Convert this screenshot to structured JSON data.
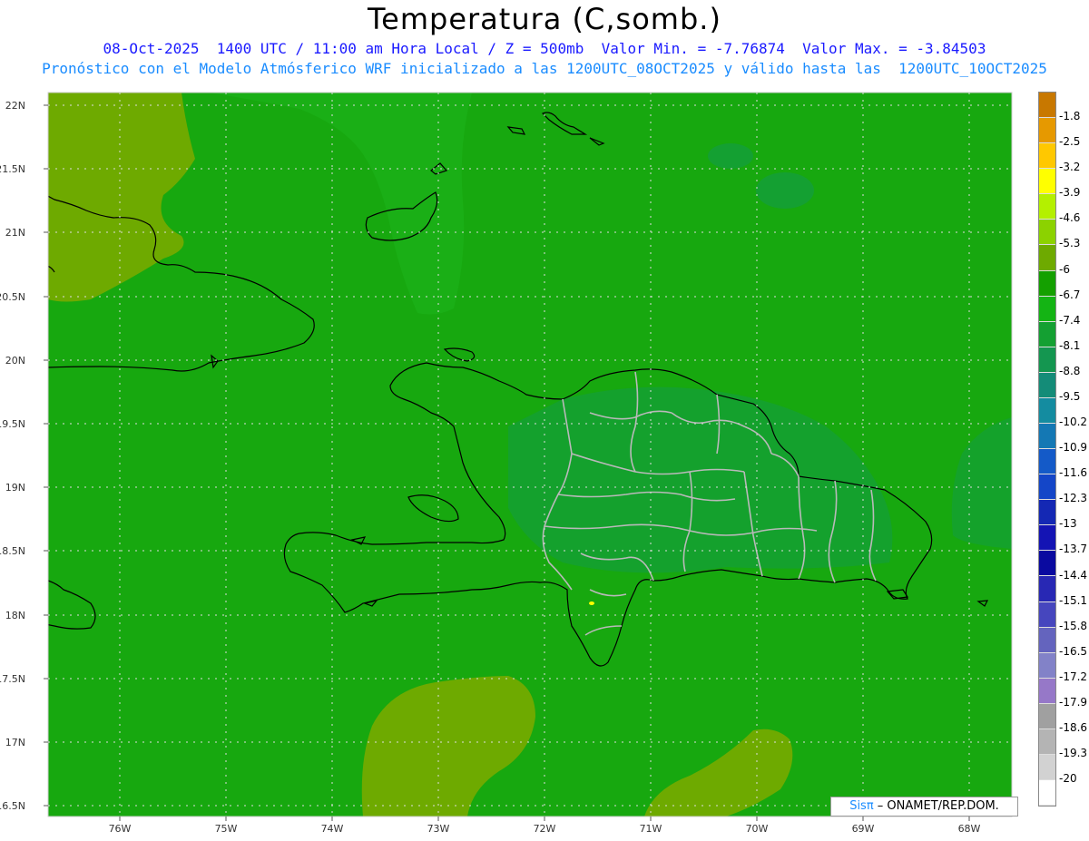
{
  "header": {
    "title": "Temperatura (C,somb.)",
    "line1": "08-Oct-2025  1400 UTC / 11:00 am Hora Local / Z = 500mb  Valor Min. = -7.76874  Valor Max. = -3.84503",
    "line2": "Pronóstico con el Modelo Atmósferico WRF inicializado a las 1200UTC_08OCT2025 y válido hasta las  1200UTC_10OCT2025"
  },
  "axes": {
    "lat_labels": [
      "22N",
      "21.5N",
      "21N",
      "20.5N",
      "20N",
      "19.5N",
      "19N",
      "18.5N",
      "18N",
      "17.5N",
      "17N",
      "16.5N"
    ],
    "lon_labels": [
      "76W",
      "75W",
      "74W",
      "73W",
      "72W",
      "71W",
      "70W",
      "69W",
      "68W"
    ]
  },
  "colorbar": {
    "labels": [
      "-1.8",
      "-2.5",
      "-3.2",
      "-3.9",
      "-4.6",
      "-5.3",
      "-6",
      "-6.7",
      "-7.4",
      "-8.1",
      "-8.8",
      "-9.5",
      "-10.2",
      "-10.9",
      "-11.6",
      "-12.3",
      "-13",
      "-13.7",
      "-14.4",
      "-15.1",
      "-15.8",
      "-16.5",
      "-17.2",
      "-17.9",
      "-18.6",
      "-19.3",
      "-20"
    ],
    "colors": [
      "#c87800",
      "#e69900",
      "#ffc800",
      "#ffff00",
      "#b4f000",
      "#8cd200",
      "#6eaa00",
      "#14a000",
      "#14b414",
      "#14a032",
      "#149650",
      "#148c78",
      "#148ca0",
      "#1478b4",
      "#145ac8",
      "#1446c8",
      "#1428b4",
      "#1414b4",
      "#0a0aa0",
      "#2828b4",
      "#4646be",
      "#6464be",
      "#8282c8",
      "#9678c8",
      "#a0a0a0",
      "#b4b4b4",
      "#d2d2d2",
      "#ffffff"
    ]
  },
  "credit": {
    "logo": "Sisπ",
    "text": " – ONAMET/REP.DOM."
  },
  "colors": {
    "field_main": "#17a80f",
    "field_warm": "#6eaa00",
    "field_cool": "#14a032"
  }
}
